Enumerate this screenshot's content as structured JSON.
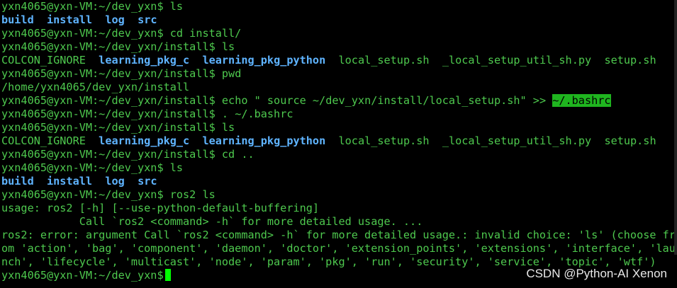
{
  "terminal": {
    "prompt_home": "yxn4065@yxn-VM:~/dev_yxn$",
    "prompt_install": "yxn4065@yxn-VM:~/dev_yxn/install$",
    "cmd_ls": "ls",
    "cmd_cd_install": "cd install/",
    "cmd_pwd": "pwd",
    "cmd_echo_a": "echo \" source ~/dev_yxn/install/local_setup.sh\" >> ",
    "cmd_echo_hl": "~/.bashrc",
    "cmd_source": ". ~/.bashrc",
    "cmd_cd_up": "cd ..",
    "cmd_ros2": "ros2 ls",
    "dir_build": "build",
    "dir_install": "install",
    "dir_log": "log",
    "dir_src": "src",
    "f_colcon": "COLCON_IGNORE",
    "d_pkg_c": "learning_pkg_c",
    "d_pkg_py": "learning_pkg_python",
    "f_local_setup": "local_setup.sh",
    "f_local_util": "_local_setup_util_sh.py",
    "f_setup": "setup.sh",
    "pwd_out": "/home/yxn4065/dev_yxn/install",
    "usage_1": "usage: ros2 [-h] [--use-python-default-buffering]",
    "usage_2": "            Call `ros2 <command> -h` for more detailed usage. ...",
    "err_1": "ros2: error: argument Call `ros2 <command> -h` for more detailed usage.: invalid choice: 'ls' (choose fr",
    "err_2": "om 'action', 'bag', 'component', 'daemon', 'doctor', 'extension_points', 'extensions', 'interface', 'lau",
    "err_3": "nch', 'lifecycle', 'multicast', 'node', 'param', 'pkg', 'run', 'security', 'service', 'topic', 'wtf')"
  },
  "watermark": "CSDN @Python-AI Xenon",
  "colors": {
    "background": "#000000",
    "text_green": "#4ec94e",
    "dir_blue": "#5fb4ff",
    "highlight": "#1fb51f",
    "cursor": "#00ff00"
  }
}
